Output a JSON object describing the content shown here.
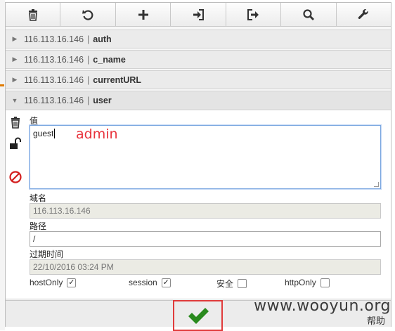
{
  "toolbar": {
    "buttons": [
      {
        "icon": "trash-icon"
      },
      {
        "icon": "undo-icon"
      },
      {
        "icon": "plus-icon"
      },
      {
        "icon": "import-icon"
      },
      {
        "icon": "export-icon"
      },
      {
        "icon": "search-icon"
      },
      {
        "icon": "wrench-icon"
      }
    ]
  },
  "cookies": [
    {
      "host": "116.113.16.146",
      "sep": "|",
      "name": "auth",
      "expanded": false
    },
    {
      "host": "116.113.16.146",
      "sep": "|",
      "name": "c_name",
      "expanded": false
    },
    {
      "host": "116.113.16.146",
      "sep": "|",
      "name": "currentURL",
      "expanded": false
    },
    {
      "host": "116.113.16.146",
      "sep": "|",
      "name": "user",
      "expanded": true
    }
  ],
  "editor": {
    "value_label": "值",
    "value": "guest",
    "overlay_text": "admin",
    "domain_label": "域名",
    "domain": "116.113.16.146",
    "path_label": "路径",
    "path": "/",
    "expires_label": "过期时间",
    "expires": "22/10/2016 03:24 PM",
    "flags": {
      "hostonly_label": "hostOnly",
      "hostonly_checked": true,
      "session_label": "session",
      "session_checked": true,
      "secure_label": "安全",
      "secure_checked": false,
      "httponly_label": "httpOnly",
      "httponly_checked": false
    }
  },
  "footer": {
    "help_label": "帮助",
    "watermark": "www.wooyun.org"
  },
  "colors": {
    "accent_red": "#e03b3b",
    "check_green": "#2a8a1e",
    "admin_red": "#e8333c"
  }
}
